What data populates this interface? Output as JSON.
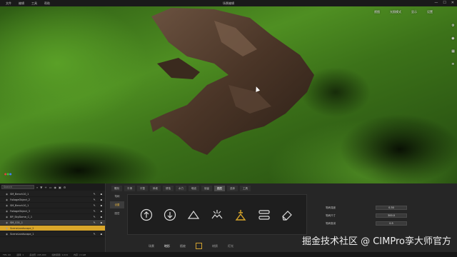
{
  "menu": [
    "文件",
    "编辑",
    "工具",
    "帮助"
  ],
  "window_title": "场景编辑",
  "window_controls": [
    "—",
    "☐",
    "✕"
  ],
  "viewport_tools": [
    "视图",
    "光照模式",
    "显示",
    "设置"
  ],
  "viewport_side_icons": [
    "gear-icon",
    "camera-icon",
    "grid-icon",
    "layers-icon"
  ],
  "outliner": {
    "search_placeholder": "Search",
    "items": [
      "SM_Bench10_1",
      "FoliageObject_2",
      "SM_Bench10_1",
      "FoliageObject_3",
      "BP_SkyDome_C_1",
      "SM_C01_1",
      "SceneLandscape_2",
      "SceneLandscape_1"
    ],
    "selected_index": 6
  },
  "tabs": [
    "雕刻",
    "平滑",
    "平整",
    "斜坡",
    "侵蚀",
    "水力",
    "噪波",
    "保留",
    "图层",
    "选择",
    "工具"
  ],
  "active_tab_index": 8,
  "subnav": [
    "笔刷",
    "设置",
    "图层"
  ],
  "subnav_active": 1,
  "brushes": [
    "raise-brush-icon",
    "lower-brush-icon",
    "flatten-brush-icon",
    "noise-brush-icon",
    "smooth-brush-icon",
    "layers-brush-icon",
    "eraser-brush-icon"
  ],
  "active_brush": 4,
  "properties": [
    {
      "label": "笔刷强度",
      "value": "0.30"
    },
    {
      "label": "笔刷尺寸",
      "value": "300.0"
    },
    {
      "label": "笔刷衰减",
      "value": "0.5"
    }
  ],
  "bottom_nav": [
    "场景",
    "地形",
    "植被",
    "",
    "材质",
    "灯光"
  ],
  "bottom_nav_active": 1,
  "status_items": [
    "FPS: 60",
    "选择: 1",
    "多边形: 245,000",
    "绘制调用: 1,024",
    "内存: 2.1GB"
  ],
  "watermark": "掘金技术社区 @ CIMPro孪大师官方",
  "colors": {
    "accent": "#d9a62a",
    "grass": "#4f8f22",
    "rock": "#4a3527"
  }
}
